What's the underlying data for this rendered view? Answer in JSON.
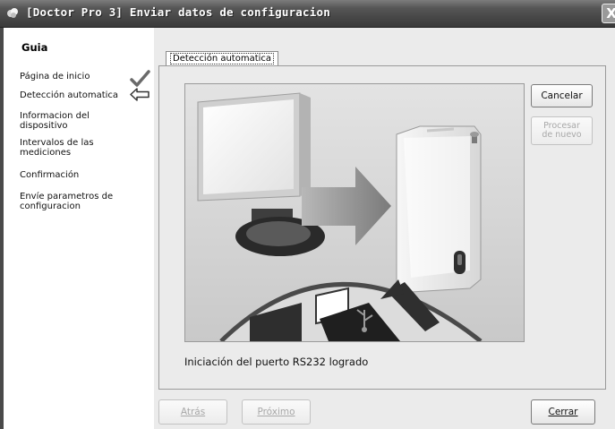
{
  "window": {
    "title": "[Doctor Pro 3] Enviar datos de configuracion",
    "close_glyph": "X"
  },
  "sidebar": {
    "heading": "Guia",
    "items": [
      {
        "label": "Página de inicio",
        "mark": "check-icon"
      },
      {
        "label": "Detección automatica",
        "mark": "arrow-left-icon"
      },
      {
        "label": "Informacion del dispositivo",
        "mark": null
      },
      {
        "label": "Intervalos de las mediciones",
        "mark": null
      },
      {
        "label": "Confirmación",
        "mark": null
      },
      {
        "label": "Envíe parametros de configuracion",
        "mark": null
      }
    ]
  },
  "main": {
    "tab_label": "Detección automatica",
    "status": "Iniciación del puerto RS232 logrado",
    "illustration": {
      "items": [
        "monitor-icon",
        "arrow-right-icon",
        "device-icon",
        "usb-plug-icon",
        "usb-symbol-icon",
        "arrow-up-left-icon"
      ]
    }
  },
  "buttons": {
    "cancel": {
      "label": "Cancelar",
      "enabled": true
    },
    "reprocess": {
      "line1": "Procesar",
      "line2": "de nuevo",
      "enabled": false
    },
    "back": {
      "label": "Atrás",
      "enabled": false
    },
    "next": {
      "label": "Próximo",
      "enabled": false
    },
    "close": {
      "label": "Cerrar",
      "enabled": true
    }
  }
}
